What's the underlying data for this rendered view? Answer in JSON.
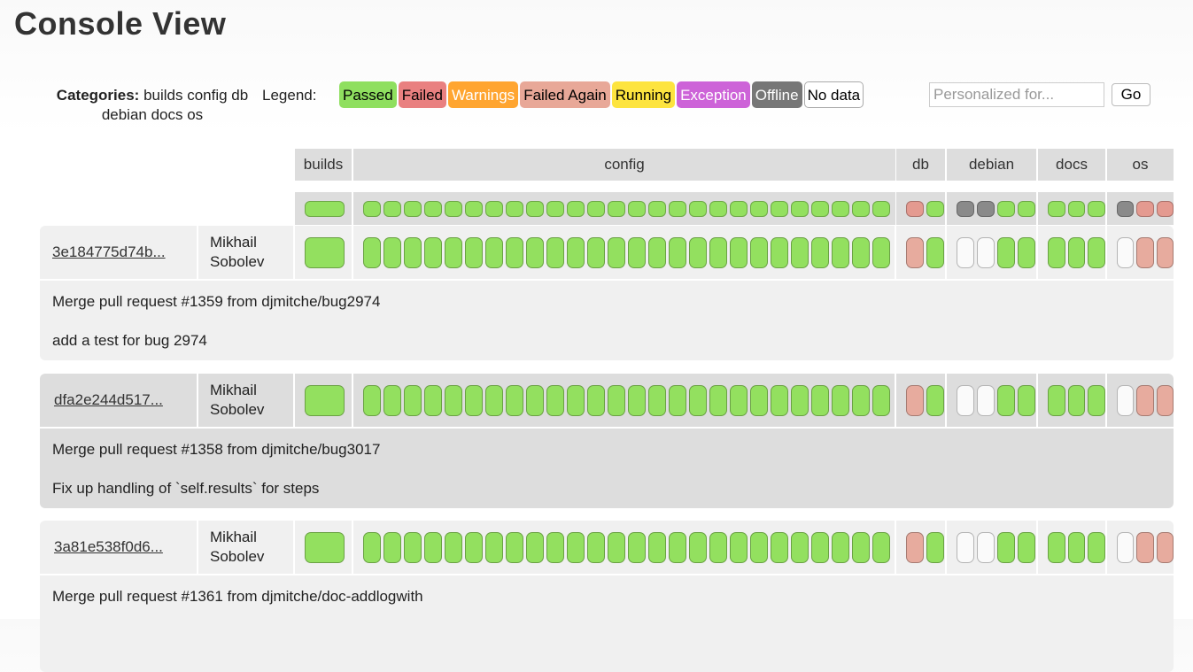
{
  "title": "Console View",
  "categories": {
    "label": "Categories:",
    "items": "builds config db debian docs os"
  },
  "legend": {
    "label": "Legend:",
    "items": [
      {
        "name": "Passed",
        "bg": "#8fdf5f",
        "fg": "#000000"
      },
      {
        "name": "Failed",
        "bg": "#e98080",
        "fg": "#000000"
      },
      {
        "name": "Warnings",
        "bg": "#ffa530",
        "fg": "#ffffff"
      },
      {
        "name": "Failed Again",
        "bg": "#e8a898",
        "fg": "#000000"
      },
      {
        "name": "Running",
        "bg": "#fde43f",
        "fg": "#000000"
      },
      {
        "name": "Exception",
        "bg": "#cd63d8",
        "fg": "#ffffff"
      },
      {
        "name": "Offline",
        "bg": "#777777",
        "fg": "#ffffff"
      },
      {
        "name": "No data",
        "bg": "#ffffff",
        "fg": "#000000"
      }
    ]
  },
  "search": {
    "placeholder": "Personalized for...",
    "button": "Go"
  },
  "colors": {
    "passed": "#93e05f",
    "failed": "#e49a90",
    "failed_again": "#e7ab9e",
    "offline": "#8a8a8a",
    "nodata": "#fafafa"
  },
  "columns": [
    {
      "name": "builds",
      "slots": 1
    },
    {
      "name": "config",
      "slots": 26
    },
    {
      "name": "db",
      "slots": 2
    },
    {
      "name": "debian",
      "slots": 4
    },
    {
      "name": "docs",
      "slots": 3
    },
    {
      "name": "os",
      "slots": 3
    }
  ],
  "aggregate": {
    "builds": [
      "passed"
    ],
    "config": [
      "passed",
      "passed",
      "passed",
      "passed",
      "passed",
      "passed",
      "passed",
      "passed",
      "passed",
      "passed",
      "passed",
      "passed",
      "passed",
      "passed",
      "passed",
      "passed",
      "passed",
      "passed",
      "passed",
      "passed",
      "passed",
      "passed",
      "passed",
      "passed",
      "passed",
      "passed"
    ],
    "db": [
      "failed",
      "passed"
    ],
    "debian": [
      "offline",
      "offline",
      "passed",
      "passed"
    ],
    "docs": [
      "passed",
      "passed",
      "passed"
    ],
    "os": [
      "offline",
      "failed",
      "failed"
    ]
  },
  "rows": [
    {
      "revision": "3e184775d74b...",
      "author": "Mikhail Sobolev",
      "comments": [
        "Merge pull request #1359 from djmitche/bug2974",
        "add a test for bug 2974"
      ],
      "builds": [
        "passed"
      ],
      "config": [
        "passed",
        "passed",
        "passed",
        "passed",
        "passed",
        "passed",
        "passed",
        "passed",
        "passed",
        "passed",
        "passed",
        "passed",
        "passed",
        "passed",
        "passed",
        "passed",
        "passed",
        "passed",
        "passed",
        "passed",
        "passed",
        "passed",
        "passed",
        "passed",
        "passed",
        "passed"
      ],
      "db": [
        "failed_again",
        "passed"
      ],
      "debian": [
        "nodata",
        "nodata",
        "passed",
        "passed"
      ],
      "docs": [
        "passed",
        "passed",
        "passed"
      ],
      "os": [
        "nodata",
        "failed_again",
        "failed_again"
      ]
    },
    {
      "revision": "dfa2e244d517...",
      "author": "Mikhail Sobolev",
      "comments": [
        "Merge pull request #1358 from djmitche/bug3017",
        "Fix up handling of `self.results` for steps"
      ],
      "builds": [
        "passed"
      ],
      "config": [
        "passed",
        "passed",
        "passed",
        "passed",
        "passed",
        "passed",
        "passed",
        "passed",
        "passed",
        "passed",
        "passed",
        "passed",
        "passed",
        "passed",
        "passed",
        "passed",
        "passed",
        "passed",
        "passed",
        "passed",
        "passed",
        "passed",
        "passed",
        "passed",
        "passed",
        "passed"
      ],
      "db": [
        "failed_again",
        "passed"
      ],
      "debian": [
        "nodata",
        "nodata",
        "passed",
        "passed"
      ],
      "docs": [
        "passed",
        "passed",
        "passed"
      ],
      "os": [
        "nodata",
        "failed_again",
        "failed_again"
      ]
    },
    {
      "revision": "3a81e538f0d6...",
      "author": "Mikhail Sobolev",
      "comments": [
        "Merge pull request #1361 from djmitche/doc-addlogwith"
      ],
      "builds": [
        "passed"
      ],
      "config": [
        "passed",
        "passed",
        "passed",
        "passed",
        "passed",
        "passed",
        "passed",
        "passed",
        "passed",
        "passed",
        "passed",
        "passed",
        "passed",
        "passed",
        "passed",
        "passed",
        "passed",
        "passed",
        "passed",
        "passed",
        "passed",
        "passed",
        "passed",
        "passed",
        "passed",
        "passed"
      ],
      "db": [
        "failed_again",
        "passed"
      ],
      "debian": [
        "nodata",
        "nodata",
        "passed",
        "passed"
      ],
      "docs": [
        "passed",
        "passed",
        "passed"
      ],
      "os": [
        "nodata",
        "failed_again",
        "failed_again"
      ]
    }
  ]
}
